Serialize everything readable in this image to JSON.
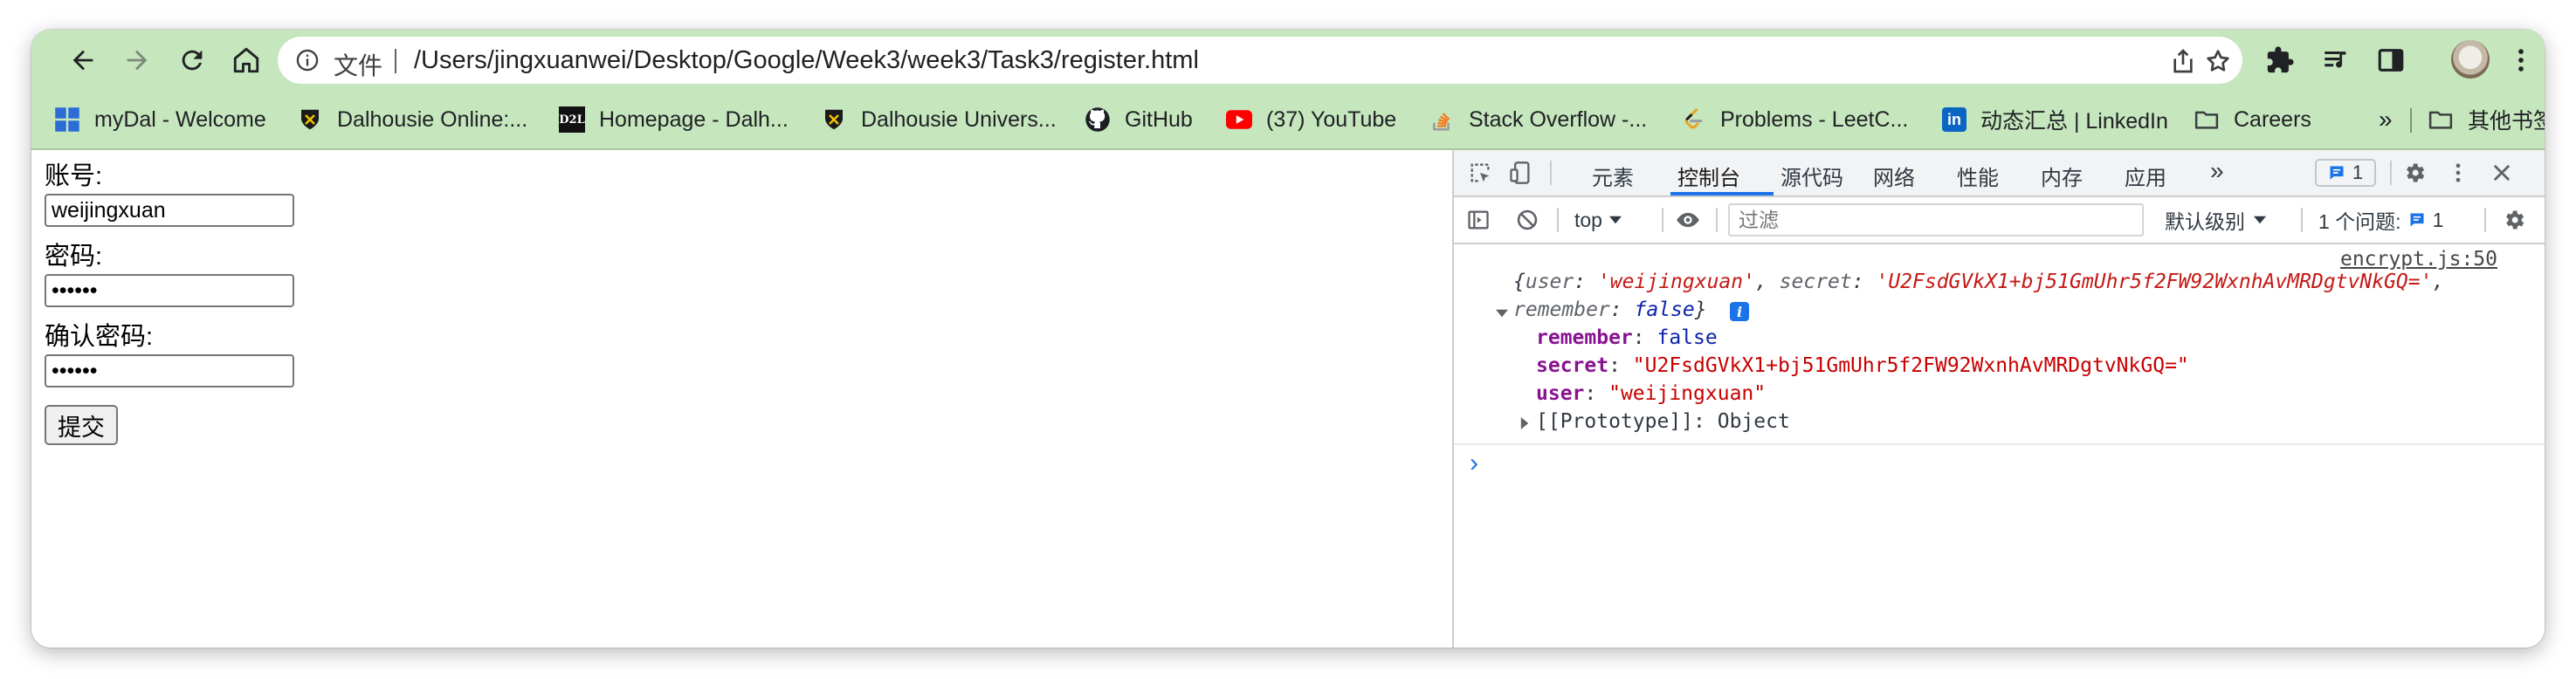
{
  "browser": {
    "omnibox": {
      "label": "文件",
      "url": "/Users/jingxuanwei/Desktop/Google/Week3/week3/Task3/register.html"
    },
    "bookmarks": [
      {
        "label": "myDal - Welcome",
        "icon": "windows-grid-icon"
      },
      {
        "label": "Dalhousie Online:...",
        "icon": "dal-crest-icon"
      },
      {
        "label": "Homepage - Dalh...",
        "icon": "d2l-icon"
      },
      {
        "label": "Dalhousie Univers...",
        "icon": "dal-crest-icon"
      },
      {
        "label": "GitHub",
        "icon": "github-icon"
      },
      {
        "label": "(37) YouTube",
        "icon": "youtube-icon"
      },
      {
        "label": "Stack Overflow -...",
        "icon": "stackoverflow-icon"
      },
      {
        "label": "Problems - LeetC...",
        "icon": "leetcode-icon"
      },
      {
        "label": "动态汇总 | LinkedIn",
        "icon": "linkedin-icon"
      },
      {
        "label": "Careers",
        "icon": "folder-icon"
      }
    ],
    "bookmarks_overflow": "»",
    "other_bookmarks": "其他书签"
  },
  "form": {
    "account_label": "账号:",
    "account_value": "weijingxuan",
    "password_label": "密码:",
    "password_value": "••••••",
    "confirm_label": "确认密码:",
    "confirm_value": "••••••",
    "submit_label": "提交"
  },
  "devtools": {
    "tabs": [
      "元素",
      "控制台",
      "源代码",
      "网络",
      "性能",
      "内存",
      "应用"
    ],
    "active_tab": "控制台",
    "more_tabs": "»",
    "issues_badge": "1",
    "context": "top",
    "filter_placeholder": "过滤",
    "level": "默认级别",
    "issues_label": "1 个问题:",
    "issues_count": "1",
    "colors": {
      "accent": "#1a73e8",
      "toolbar": "#c6e6be"
    },
    "console": {
      "source": "encrypt.js:50",
      "summary": {
        "open": "{",
        "user_key": "user",
        "user_val": "'weijingxuan'",
        "secret_key": "secret",
        "secret_val": "'U2FsdGVkX1+bj51GmUhr5f2FW92WxnhAvMRDgtvNkGQ='",
        "remember_key": "remember",
        "remember_val": "false",
        "close": "}",
        "info_icon": "i"
      },
      "props": [
        {
          "key": "remember",
          "value": "false",
          "kind": "kw"
        },
        {
          "key": "secret",
          "value": "\"U2FsdGVkX1+bj51GmUhr5f2FW92WxnhAvMRDgtvNkGQ=\"",
          "kind": "str"
        },
        {
          "key": "user",
          "value": "\"weijingxuan\"",
          "kind": "str"
        }
      ],
      "prototype": "[[Prototype]]",
      "prototype_value": "Object",
      "prompt": "›"
    }
  }
}
